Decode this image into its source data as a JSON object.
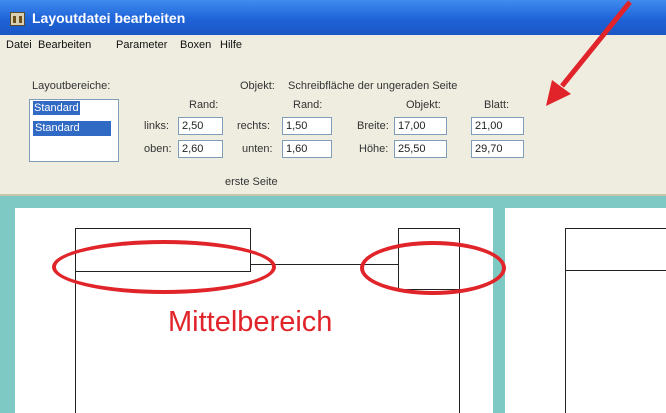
{
  "window": {
    "title": "Layoutdatei bearbeiten"
  },
  "menu": [
    "Datei",
    "Bearbeiten",
    "Parameter",
    "Boxen",
    "Hilfe"
  ],
  "panel": {
    "layout_label": "Layoutbereiche:",
    "list_top": "Standard",
    "list_selected": "Standard",
    "objekt_label": "Objekt:",
    "objekt_value": "Schreibfläche der ungeraden Seite",
    "rand_label_1": "Rand:",
    "rand_label_2": "Rand:",
    "objekt_col_label": "Objekt:",
    "blatt_label": "Blatt:",
    "links_label": "links:",
    "links_value": "2,50",
    "oben_label": "oben:",
    "oben_value": "2,60",
    "rechts_label": "rechts:",
    "rechts_value": "1,50",
    "unten_label": "unten:",
    "unten_value": "1,60",
    "breite_label": "Breite:",
    "breite_objekt": "17,00",
    "breite_blatt": "21,00",
    "hoehe_label": "Höhe:",
    "hoehe_objekt": "25,50",
    "hoehe_blatt": "29,70",
    "page_caption": "erste Seite"
  },
  "annotation": {
    "label": "Mittelbereich",
    "color": "#e0242a"
  },
  "colors": {
    "title_bar": "#1f63d8",
    "panel": "#efede0",
    "workspace": "#7fc9c4",
    "selection": "#316ac5"
  }
}
